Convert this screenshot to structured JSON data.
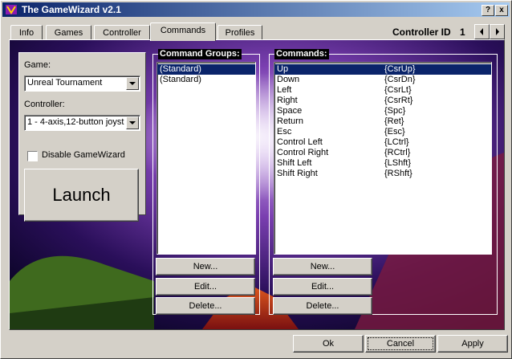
{
  "window": {
    "title": "The GameWizard v2.1",
    "help_label": "?",
    "close_label": "x"
  },
  "tabs": [
    "Info",
    "Games",
    "Controller",
    "Commands",
    "Profiles"
  ],
  "active_tab": "Commands",
  "controller_id": {
    "label": "Controller ID",
    "value": "1"
  },
  "left_panel": {
    "game_label": "Game:",
    "game_value": "Unreal Tournament",
    "controller_label": "Controller:",
    "controller_value": "1 - 4-axis,12-button joyst",
    "disable_label": "Disable GameWizard",
    "disable_checked": false,
    "launch_label": "Launch"
  },
  "command_groups": {
    "title": "Command Groups:",
    "items": [
      "(Standard)",
      "(Standard)"
    ],
    "selected_index": 0,
    "buttons": {
      "new": "New...",
      "edit": "Edit...",
      "delete": "Delete..."
    }
  },
  "commands": {
    "title": "Commands:",
    "items": [
      {
        "name": "Up",
        "key": "{CsrUp}"
      },
      {
        "name": "Down",
        "key": "{CsrDn}"
      },
      {
        "name": "Left",
        "key": "{CsrLt}"
      },
      {
        "name": "Right",
        "key": "{CsrRt}"
      },
      {
        "name": "Space",
        "key": "{Spc}"
      },
      {
        "name": "Return",
        "key": "{Ret}"
      },
      {
        "name": "Esc",
        "key": "{Esc}"
      },
      {
        "name": "Control Left",
        "key": "{LCtrl}"
      },
      {
        "name": "Control Right",
        "key": "{RCtrl}"
      },
      {
        "name": "Shift Left",
        "key": "{LShft}"
      },
      {
        "name": "Shift Right",
        "key": "{RShft}"
      }
    ],
    "selected_index": 0,
    "buttons": {
      "new": "New...",
      "edit": "Edit...",
      "delete": "Delete..."
    }
  },
  "footer": {
    "ok": "Ok",
    "cancel": "Cancel",
    "apply": "Apply"
  },
  "colors": {
    "title_bar": "#0a246a",
    "selection": "#0a246a",
    "face": "#d4d0c8"
  }
}
